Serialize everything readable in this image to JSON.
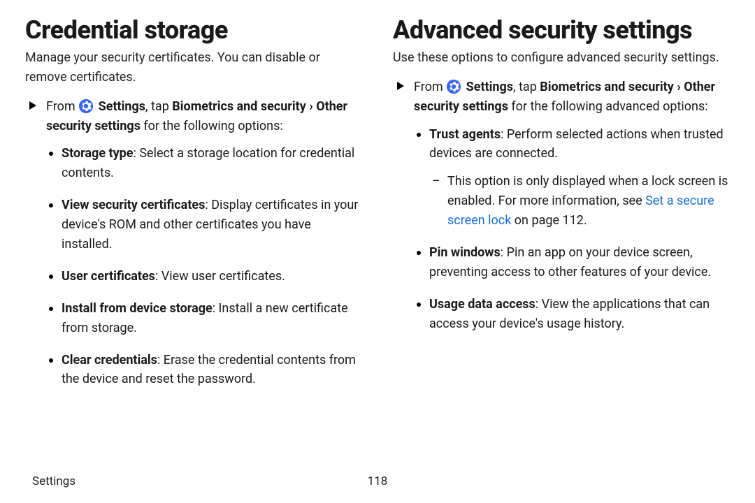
{
  "left": {
    "heading": "Credential storage",
    "intro": "Manage your security certificates. You can disable or remove certificates.",
    "step_prefix": "From ",
    "step_settings": "Settings",
    "step_tap": ", tap ",
    "step_path1": "Biometrics and security",
    "step_chev": " › ",
    "step_path2": "Other security settings",
    "step_suffix": " for the following options:",
    "items": [
      {
        "title": "Storage type",
        "desc": ": Select a storage location for credential contents."
      },
      {
        "title": "View security certificates",
        "desc": ": Display certificates in your device's ROM and other certificates you have installed."
      },
      {
        "title": "User certificates",
        "desc": ": View user certificates."
      },
      {
        "title": "Install from device storage",
        "desc": ": Install a new certificate from storage."
      },
      {
        "title": "Clear credentials",
        "desc": ": Erase the credential contents from the device and reset the password."
      }
    ]
  },
  "right": {
    "heading": "Advanced security settings",
    "intro": "Use these options to configure advanced security settings.",
    "step_prefix": "From ",
    "step_settings": "Settings",
    "step_tap": ", tap ",
    "step_path1": "Biometrics and security",
    "step_chev": " › ",
    "step_path2": "Other security settings",
    "step_suffix": " for the following advanced options:",
    "items": [
      {
        "title": "Trust agents",
        "desc": ": Perform selected actions when trusted devices are connected.",
        "note_before": "This option is only displayed when a lock screen is enabled. For more information, see ",
        "note_link": "Set a secure screen lock",
        "note_after": " on page 112."
      },
      {
        "title": "Pin windows",
        "desc": ": Pin an app on your device screen, preventing access to other features of your device."
      },
      {
        "title": "Usage data access",
        "desc": ": View the applications that can access your device's usage history."
      }
    ]
  },
  "footer": {
    "section": "Settings",
    "page": "118"
  }
}
